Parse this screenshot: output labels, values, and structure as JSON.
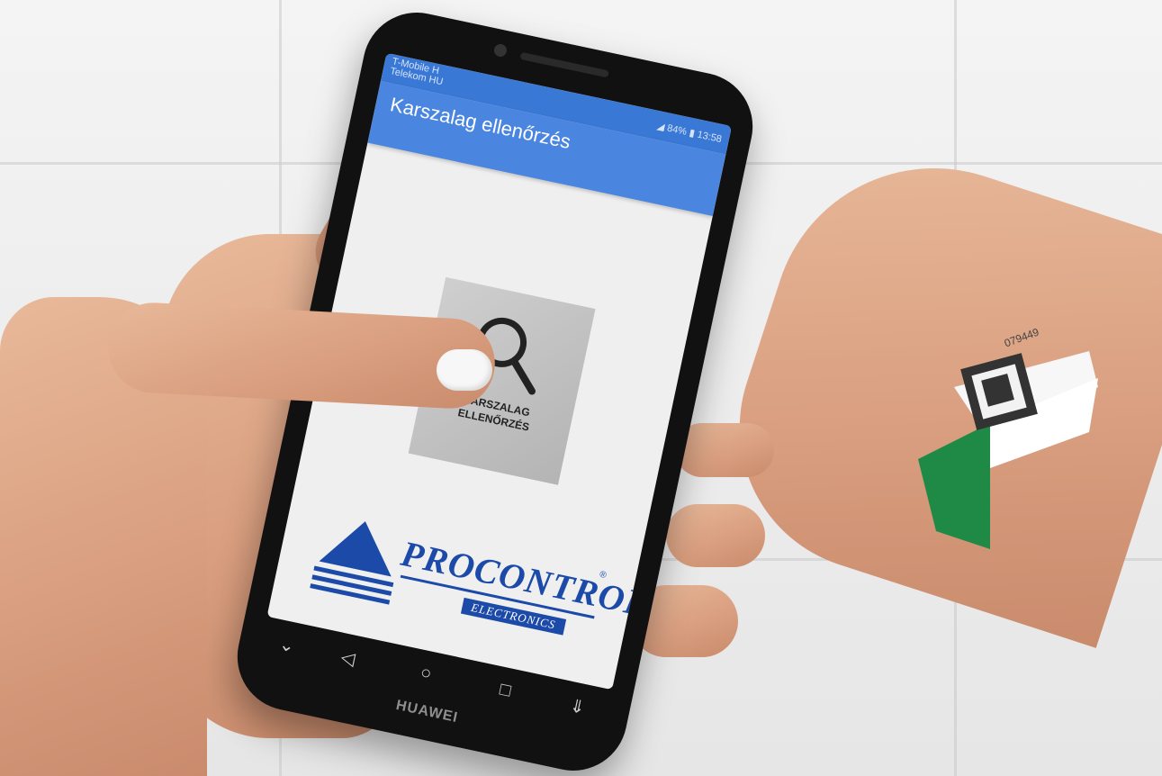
{
  "status_bar": {
    "carrier_line1": "T-Mobile H",
    "carrier_line2": "Telekom HU",
    "battery": "84%",
    "time": "13:58"
  },
  "app_bar": {
    "title": "Karszalag ellenőrzés"
  },
  "main_tile": {
    "icon": "search-icon",
    "label_line1": "KARSZALAG",
    "label_line2": "ELLENŐRZÉS"
  },
  "logo": {
    "name": "PROCONTROL",
    "subtitle": "ELECTRONICS",
    "reg_mark": "®"
  },
  "navbar": {
    "icons": [
      "chevron-down-icon",
      "back-icon",
      "home-icon",
      "recents-icon",
      "pull-down-icon"
    ]
  },
  "device_brand": "HUAWEI",
  "wristband_code": "079449",
  "colors": {
    "app_bar": "#4a86e0",
    "logo_blue": "#1b4aa8",
    "wristband_green": "#1f8a45"
  }
}
